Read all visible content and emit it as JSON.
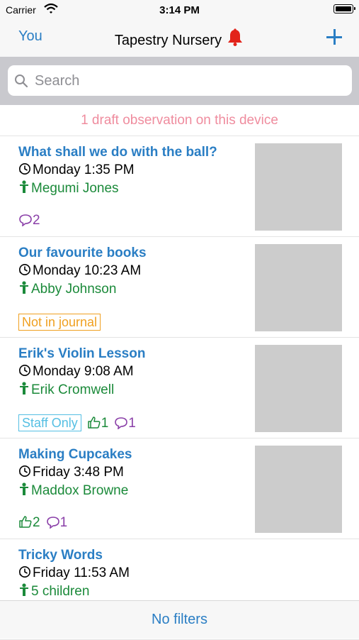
{
  "status_bar": {
    "carrier": "Carrier",
    "time": "3:14 PM"
  },
  "nav": {
    "left_label": "You",
    "title": "Tapestry Nursery"
  },
  "search": {
    "placeholder": "Search"
  },
  "draft_banner": "1 draft observation on this device",
  "observations": [
    {
      "title": "What shall we do with the ball?",
      "time": "Monday 1:35 PM",
      "child": "Megumi Jones",
      "comments": "2"
    },
    {
      "title": "Our favourite books",
      "time": "Monday 10:23 AM",
      "child": "Abby Johnson",
      "badge": "Not in journal"
    },
    {
      "title": "Erik's Violin Lesson",
      "time": "Monday 9:08 AM",
      "child": "Erik Cromwell",
      "badge": "Staff Only",
      "likes": "1",
      "comments": "1"
    },
    {
      "title": "Making Cupcakes",
      "time": "Friday 3:48 PM",
      "child": "Maddox Browne",
      "likes": "2",
      "comments": "1"
    },
    {
      "title": "Tricky Words",
      "time": "Friday 11:53 AM",
      "child": "5 children"
    }
  ],
  "footer": {
    "filters_label": "No filters"
  },
  "colors": {
    "accent": "#2a7ec4",
    "child": "#1b8a3a",
    "comment": "#8a3fa8",
    "draft": "#ef8c9e",
    "not_in_journal": "#f0a020",
    "staff_only": "#55bfe3",
    "bell": "#e2231a"
  },
  "icons": [
    "wifi-icon",
    "battery-icon",
    "bell-icon",
    "plus-icon",
    "search-icon",
    "clock-icon",
    "child-icon",
    "comment-icon",
    "like-icon"
  ]
}
